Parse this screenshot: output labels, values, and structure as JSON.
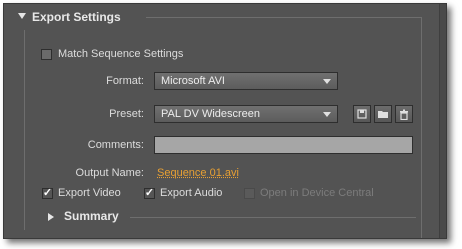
{
  "section": {
    "title": "Export Settings"
  },
  "match_sequence": {
    "label": "Match Sequence Settings",
    "checked": false
  },
  "format": {
    "label": "Format:",
    "value": "Microsoft AVI"
  },
  "preset": {
    "label": "Preset:",
    "value": "PAL DV Widescreen"
  },
  "preset_buttons": {
    "save": "save-preset-icon",
    "import": "import-preset-icon",
    "delete": "delete-preset-icon"
  },
  "comments": {
    "label": "Comments:",
    "value": ""
  },
  "output": {
    "label": "Output Name:",
    "value": "Sequence 01.avi"
  },
  "export_video": {
    "label": "Export Video",
    "checked": true
  },
  "export_audio": {
    "label": "Export Audio",
    "checked": true
  },
  "device_central": {
    "label": "Open in Device Central",
    "checked": false,
    "enabled": false
  },
  "summary": {
    "title": "Summary"
  },
  "colors": {
    "panel_bg": "#535353",
    "link": "#e8a033",
    "field_bg": "#a6a6a6"
  }
}
